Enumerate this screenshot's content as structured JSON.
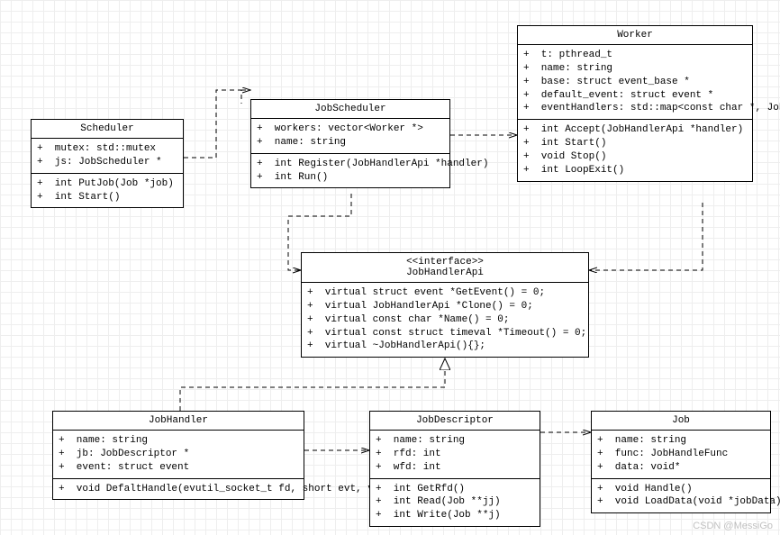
{
  "watermark": "CSDN @MessiGo",
  "classes": {
    "scheduler": {
      "name": "Scheduler",
      "attrs": [
        "+  mutex: std::mutex",
        "+  js: JobScheduler *"
      ],
      "ops": [
        "+  int PutJob(Job *job)",
        "+  int Start()"
      ]
    },
    "jobScheduler": {
      "name": "JobScheduler",
      "attrs": [
        "+  workers: vector<Worker *>",
        "+  name: string"
      ],
      "ops": [
        "+  int Register(JobHandlerApi *handler)",
        "+  int Run()"
      ]
    },
    "worker": {
      "name": "Worker",
      "attrs": [
        "+  t: pthread_t",
        "+  name: string",
        "+  base: struct event_base *",
        "+  default_event: struct event *",
        "+  eventHandlers: std::map<const char *, JobHandlerApi *>"
      ],
      "ops": [
        "+  int Accept(JobHandlerApi *handler)",
        "+  int Start()",
        "+  void Stop()",
        "+  int LoopExit()"
      ]
    },
    "jobHandlerApi": {
      "stereotype": "<<interface>>",
      "name": "JobHandlerApi",
      "ops": [
        "+  virtual struct event *GetEvent() = 0;",
        "+  virtual JobHandlerApi *Clone() = 0;",
        "+  virtual const char *Name() = 0;",
        "+  virtual const struct timeval *Timeout() = 0;",
        "+  virtual ~JobHandlerApi(){};"
      ]
    },
    "jobHandler": {
      "name": "JobHandler",
      "attrs": [
        "+  name: string",
        "+  jb: JobDescriptor *",
        "+  event: struct event"
      ],
      "ops": [
        "+  void DefaltHandle(evutil_socket_t fd, short evt, void *ptr)"
      ]
    },
    "jobDescriptor": {
      "name": "JobDescriptor",
      "attrs": [
        "+  name: string",
        "+  rfd: int",
        "+  wfd: int"
      ],
      "ops": [
        "+  int GetRfd()",
        "+  int Read(Job **jj)",
        "+  int Write(Job **j)"
      ]
    },
    "job": {
      "name": "Job",
      "attrs": [
        "+  name: string",
        "+  func: JobHandleFunc",
        "+  data: void*"
      ],
      "ops": [
        "+  void Handle()",
        "+  void LoadData(void *jobData)"
      ]
    }
  },
  "chart_data": {
    "type": "uml-class-diagram",
    "nodes": [
      "Scheduler",
      "JobScheduler",
      "Worker",
      "JobHandlerApi",
      "JobHandler",
      "JobDescriptor",
      "Job"
    ],
    "edges": [
      {
        "from": "Scheduler",
        "to": "JobScheduler",
        "kind": "dependency"
      },
      {
        "from": "JobScheduler",
        "to": "Worker",
        "kind": "dependency"
      },
      {
        "from": "JobScheduler",
        "to": "JobHandlerApi",
        "kind": "dependency"
      },
      {
        "from": "Worker",
        "to": "JobHandlerApi",
        "kind": "dependency"
      },
      {
        "from": "JobHandler",
        "to": "JobHandlerApi",
        "kind": "realization"
      },
      {
        "from": "JobHandler",
        "to": "JobDescriptor",
        "kind": "dependency"
      },
      {
        "from": "JobDescriptor",
        "to": "Job",
        "kind": "dependency"
      }
    ]
  }
}
